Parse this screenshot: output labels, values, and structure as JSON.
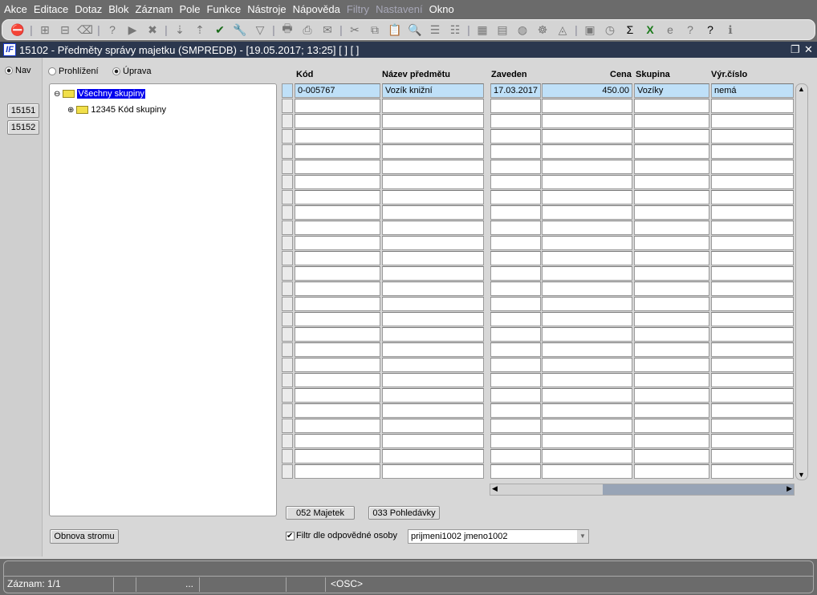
{
  "menu": [
    {
      "label": "Akce"
    },
    {
      "label": "Editace"
    },
    {
      "label": "Dotaz"
    },
    {
      "label": "Blok"
    },
    {
      "label": "Záznam"
    },
    {
      "label": "Pole"
    },
    {
      "label": "Funkce"
    },
    {
      "label": "Nástroje"
    },
    {
      "label": "Nápověda"
    },
    {
      "label": "Filtry",
      "disabled": true
    },
    {
      "label": "Nastavení",
      "disabled": true
    },
    {
      "label": "Okno"
    }
  ],
  "toolbar": [
    "exit",
    "sep",
    "insert-record",
    "remove-record",
    "clear-record",
    "sep",
    "enter-query",
    "execute-query",
    "cancel-query",
    "sep",
    "sort-ascending",
    "sort-descending",
    "save-check",
    "wrench",
    "filter",
    "sep",
    "print",
    "print-setup",
    "mail",
    "sep",
    "cut",
    "copy",
    "paste",
    "search",
    "indent",
    "outdent",
    "sep",
    "calendar",
    "notes",
    "globe",
    "helm",
    "eye",
    "sep",
    "chart",
    "clock",
    "sigma",
    "excel",
    "browser",
    "help-query",
    "help",
    "info"
  ],
  "title": "15102 - Předměty správy majetku (SMPREDB) - [19.05.2017; 13:25]  [ ]  [ ]",
  "nav": {
    "mode_label": "Nav",
    "buttons": [
      "15151",
      "15152"
    ]
  },
  "mode": {
    "view_label": "Prohlížení",
    "edit_label": "Úprava"
  },
  "tree": {
    "root": "Všechny skupiny",
    "child": "12345 Kód skupiny",
    "refresh_label": "Obnova stromu"
  },
  "grid": {
    "columns": [
      "Kód",
      "Název předmětu",
      "Zaveden",
      "Cena",
      "Skupina",
      "Výr.číslo"
    ],
    "rows": [
      [
        "0-005767",
        "Vozík knižní",
        "17.03.2017",
        "450.00",
        "Vozíky",
        "nemá"
      ]
    ],
    "total_rows": 26
  },
  "buttons": {
    "majetek": "052 Majetek",
    "pohledavky": "033 Pohledávky"
  },
  "filter": {
    "label": "Filtr dle odpovědné osoby",
    "checked": true,
    "value": "prijmeni1002 jmeno1002"
  },
  "status": {
    "record": "Záznam: 1/1",
    "ellipsis": "...",
    "mode": "<OSC>"
  }
}
